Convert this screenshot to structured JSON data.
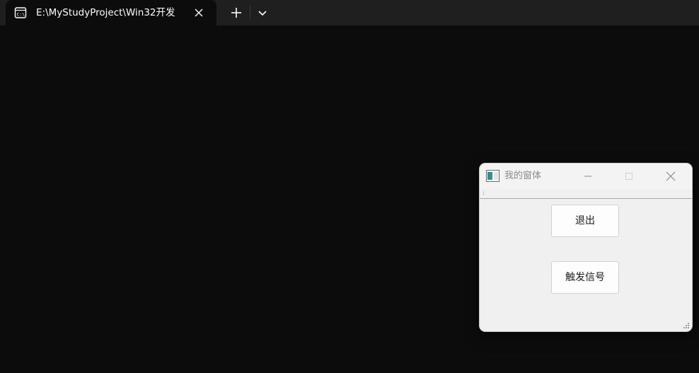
{
  "terminal": {
    "tab_title": "E:\\MyStudyProject\\Win32开发",
    "icons": {
      "tab": "terminal-icon",
      "close": "close-icon",
      "new_tab": "plus-icon",
      "dropdown": "chevron-down-icon"
    }
  },
  "window": {
    "title": "我的窗体",
    "icons": {
      "app": "window-icon",
      "minimize": "minimize-icon",
      "maximize": "maximize-icon",
      "close": "close-icon"
    },
    "buttons": {
      "exit_label": "退出",
      "signal_label": "触发信号"
    }
  },
  "colors": {
    "terminal_bg": "#0c0c0c",
    "tabbar_bg": "#1f1f1f",
    "window_bg": "#f0f0f0"
  }
}
